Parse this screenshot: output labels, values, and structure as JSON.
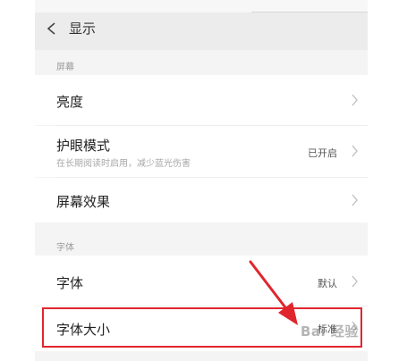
{
  "header": {
    "title": "显示"
  },
  "sections": [
    {
      "label": "屏幕",
      "items": [
        {
          "label": "亮度",
          "value": "",
          "subtitle": ""
        },
        {
          "label": "护眼模式",
          "value": "已开启",
          "subtitle": "在长期阅读时启用，减少蓝光伤害"
        },
        {
          "label": "屏幕效果",
          "value": "",
          "subtitle": ""
        }
      ]
    },
    {
      "label": "字体",
      "items": [
        {
          "label": "字体",
          "value": "默认",
          "subtitle": ""
        },
        {
          "label": "字体大小",
          "value": "标准",
          "subtitle": ""
        }
      ]
    }
  ],
  "watermark": "Bai 经验",
  "colors": {
    "highlight": "#e0262d",
    "arrow": "#e0262d",
    "background": "#f4f4f4"
  },
  "icons": {
    "back": "chevron-left-icon",
    "row": "chevron-right-icon"
  }
}
